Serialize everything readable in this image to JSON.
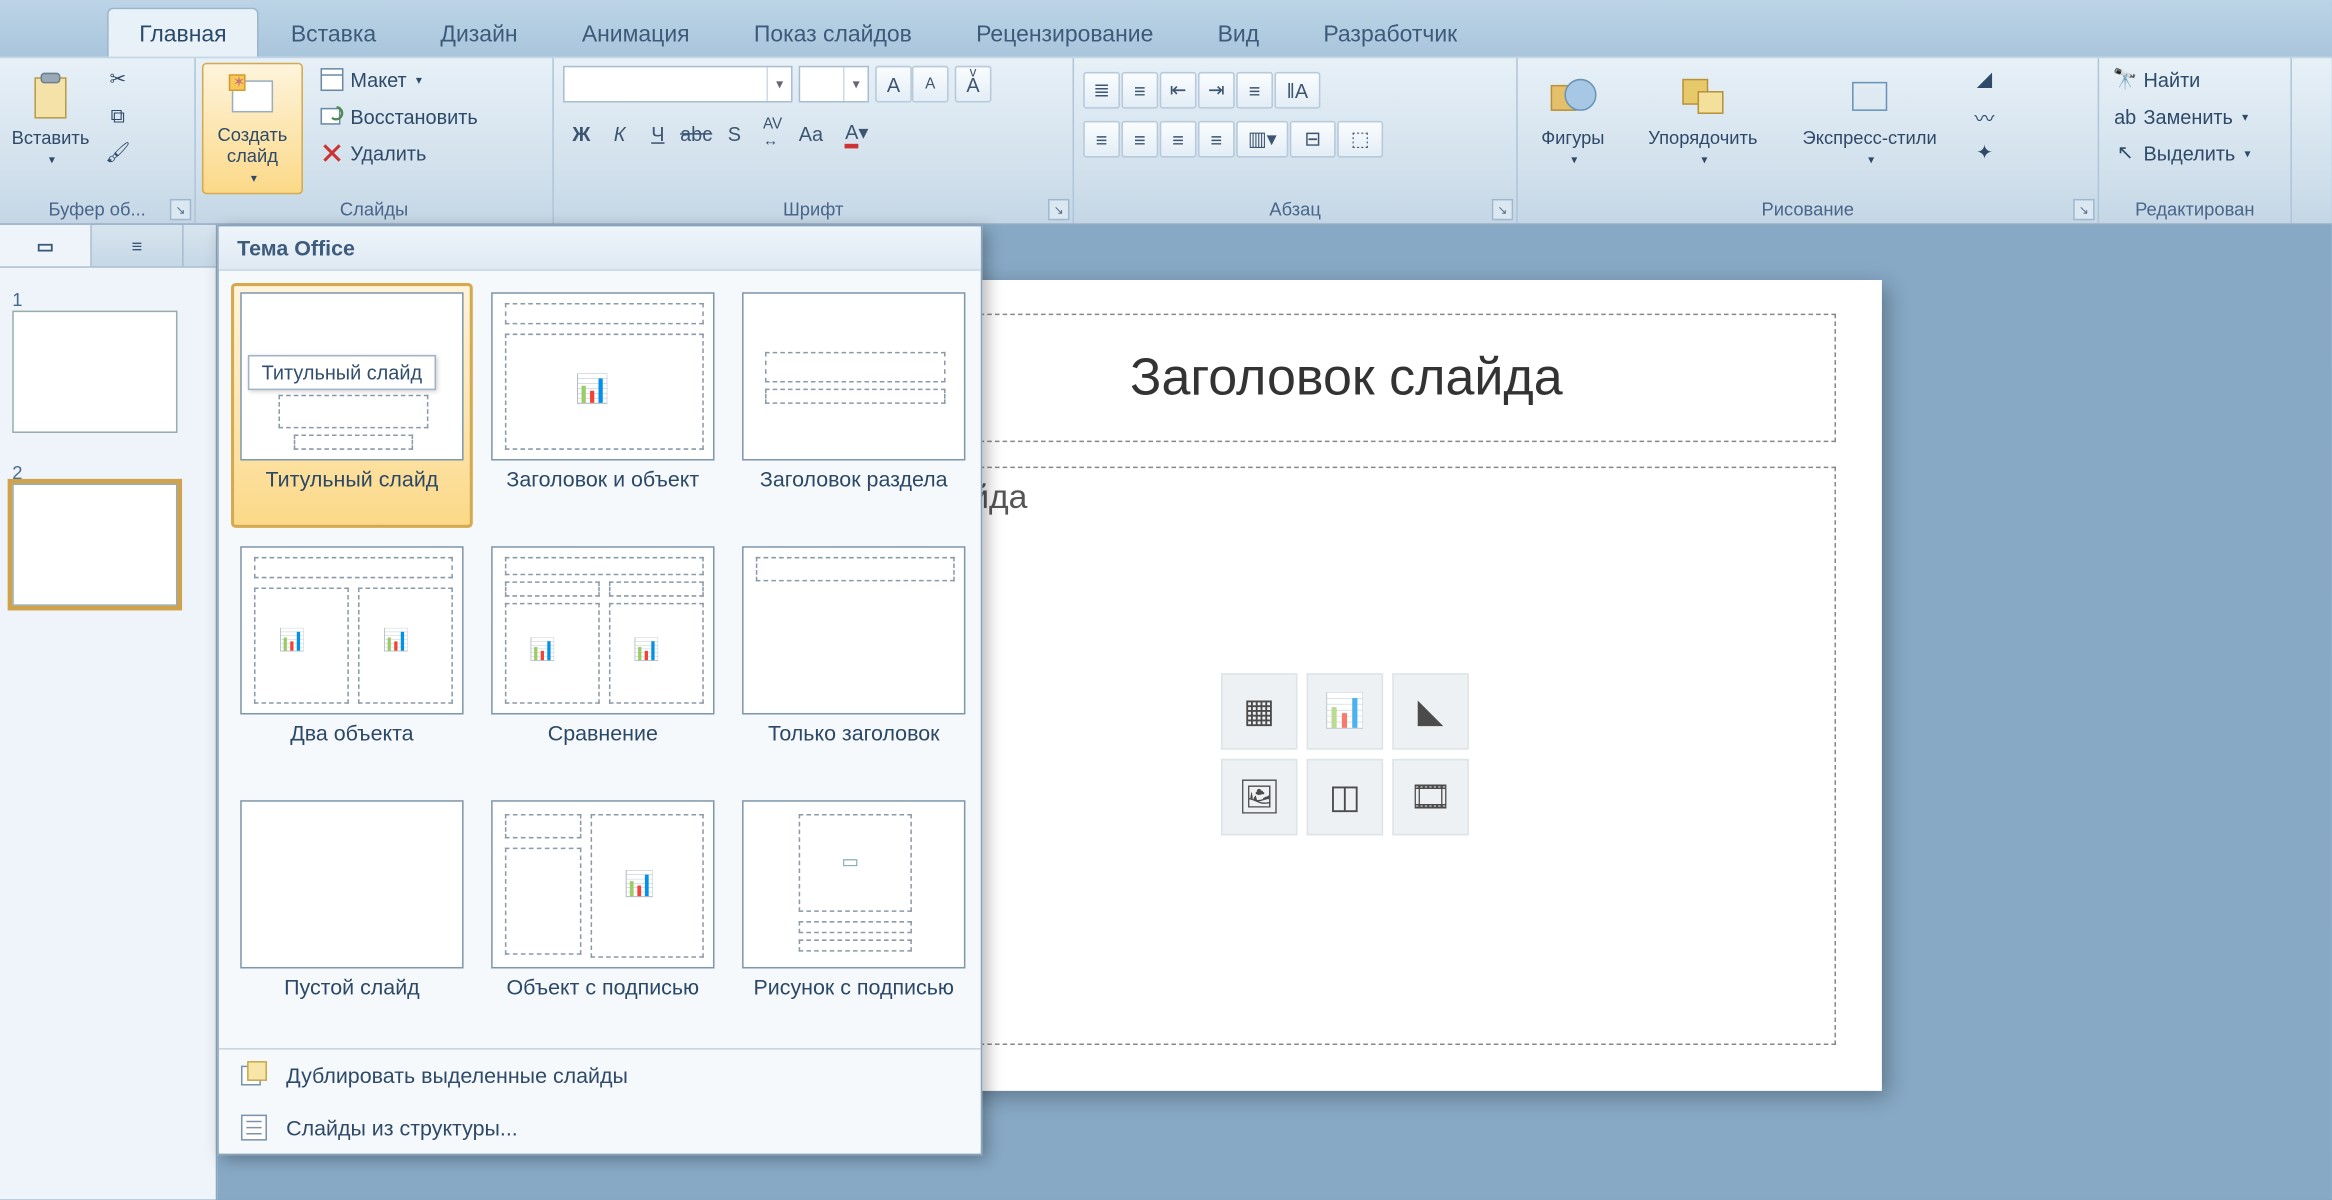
{
  "tabs": {
    "items": [
      "Главная",
      "Вставка",
      "Дизайн",
      "Анимация",
      "Показ слайдов",
      "Рецензирование",
      "Вид",
      "Разработчик"
    ],
    "active": "Главная"
  },
  "ribbon": {
    "clipboard": {
      "label": "Буфер об...",
      "paste": "Вставить"
    },
    "slides": {
      "label": "Слайды",
      "new": "Создать слайд",
      "layout": "Макет",
      "reset": "Восстановить",
      "delete": "Удалить"
    },
    "font": {
      "label": "Шрифт"
    },
    "paragraph": {
      "label": "Абзац"
    },
    "drawing": {
      "label": "Рисование",
      "shapes": "Фигуры",
      "arrange": "Упорядочить",
      "styles": "Экспресс-стили"
    },
    "editing": {
      "label": "Редактирован",
      "find": "Найти",
      "replace": "Заменить",
      "select": "Выделить"
    }
  },
  "gallery": {
    "title": "Тема Office",
    "tooltip": "Титульный слайд",
    "layouts": [
      "Титульный слайд",
      "Заголовок и объект",
      "Заголовок раздела",
      "Два объекта",
      "Сравнение",
      "Только заголовок",
      "Пустой слайд",
      "Объект с подписью",
      "Рисунок с подписью"
    ],
    "actions": {
      "duplicate": "Дублировать выделенные слайды",
      "outline": "Слайды из структуры..."
    }
  },
  "nav": {
    "slide1_num": "1",
    "slide2_num": "2"
  },
  "slide": {
    "title_placeholder": "Заголовок слайда",
    "body_text_fragment": "кст слайда"
  },
  "icons": {
    "cut": "cut",
    "copy": "copy",
    "fmtpaint": "format-painter",
    "layout": "layout",
    "reset": "reset",
    "delete": "delete",
    "bold": "B",
    "italic": "K",
    "underline": "Ч",
    "find": "find",
    "replace": "replace",
    "select": "select"
  }
}
